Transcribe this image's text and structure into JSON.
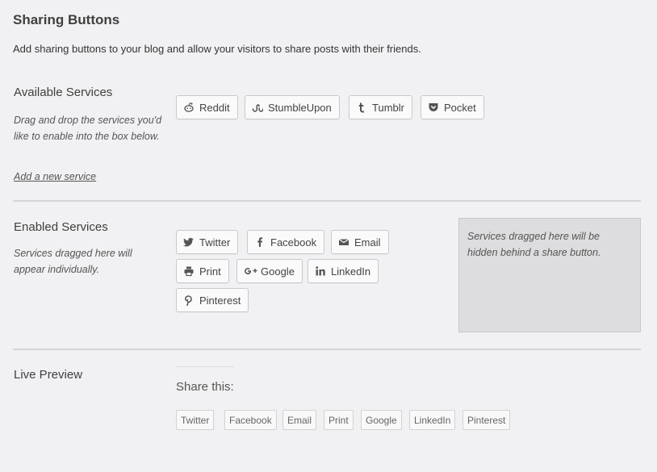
{
  "header": {
    "title": "Sharing Buttons",
    "intro": "Add sharing buttons to your blog and allow your visitors to share posts with their friends."
  },
  "available": {
    "title": "Available Services",
    "description": "Drag and drop the services you'd like to enable into the box below.",
    "add_link": "Add a new service",
    "services": [
      {
        "label": "Reddit",
        "icon": "reddit-icon"
      },
      {
        "label": "StumbleUpon",
        "icon": "stumbleupon-icon"
      },
      {
        "label": "Tumblr",
        "icon": "tumblr-icon"
      },
      {
        "label": "Pocket",
        "icon": "pocket-icon"
      }
    ]
  },
  "enabled": {
    "title": "Enabled Services",
    "description": "Services dragged here will appear individually.",
    "hidden_box_text": "Services dragged here will be hidden behind a share button.",
    "services": [
      {
        "label": "Twitter",
        "icon": "twitter-icon"
      },
      {
        "label": "Facebook",
        "icon": "facebook-icon"
      },
      {
        "label": "Email",
        "icon": "email-icon"
      },
      {
        "label": "Print",
        "icon": "print-icon"
      },
      {
        "label": "Google",
        "icon": "google-plus-icon"
      },
      {
        "label": "LinkedIn",
        "icon": "linkedin-icon"
      },
      {
        "label": "Pinterest",
        "icon": "pinterest-icon"
      }
    ]
  },
  "preview": {
    "title": "Live Preview",
    "share_label": "Share this:",
    "buttons": [
      "Twitter",
      "Facebook",
      "Email",
      "Print",
      "Google",
      "LinkedIn",
      "Pinterest"
    ]
  },
  "colors": {
    "background": "#f1f1f3",
    "button_border": "#c9c9cc",
    "hidden_box": "#dddddf"
  }
}
